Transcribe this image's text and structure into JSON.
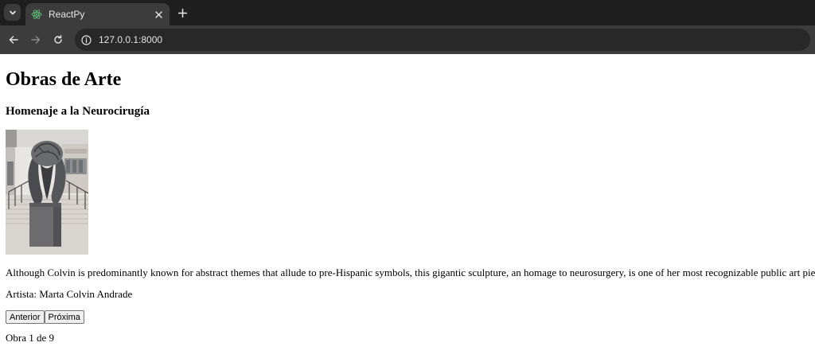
{
  "browser": {
    "tab_title": "ReactPy",
    "url": "127.0.0.1:8000",
    "icons": {
      "tab_search": "chevron-down-icon",
      "favicon": "react-icon",
      "close": "close-icon",
      "new_tab": "plus-icon",
      "back": "back-arrow-icon",
      "forward": "forward-arrow-icon",
      "reload": "reload-icon",
      "site_info": "info-icon"
    }
  },
  "page": {
    "heading": "Obras de Arte",
    "artwork_title": "Homenaje a la Neurocirugía",
    "description": "Although Colvin is predominantly known for abstract themes that allude to pre-Hispanic symbols, this gigantic sculpture, an homage to neurosurgery, is one of her most recognizable public art pieces.",
    "artist": "Artista: Marta Colvin Andrade",
    "prev_button": "Anterior",
    "next_button": "Próxima",
    "counter": "Obra 1 de 9"
  },
  "colors": {
    "tabbar_bg": "#1f1f1f",
    "toolbar_bg": "#3c3c3c",
    "omnibox_bg": "#282828",
    "favicon": "#5fb878"
  }
}
